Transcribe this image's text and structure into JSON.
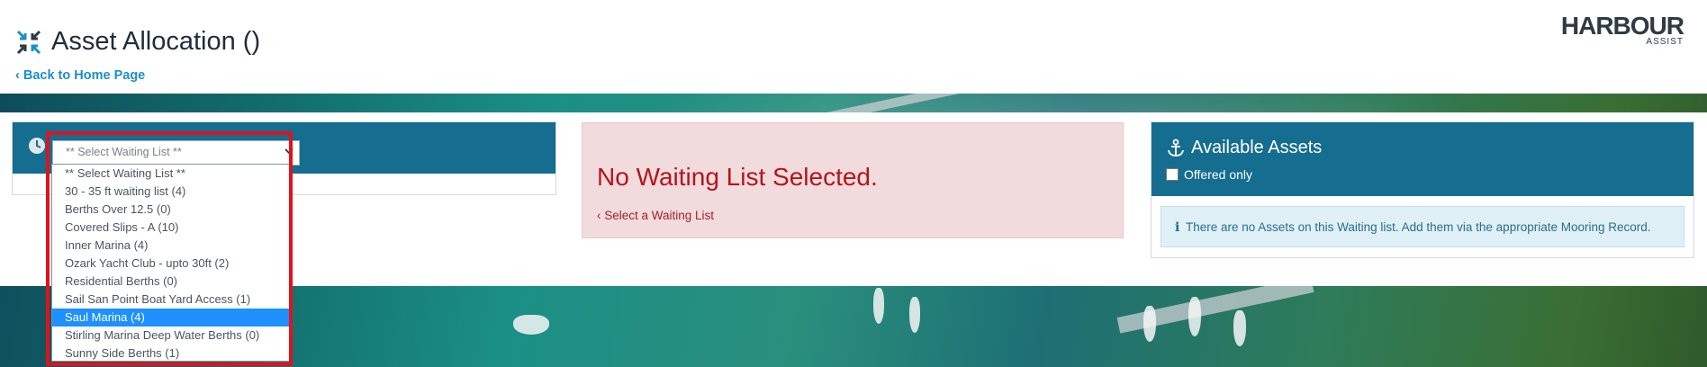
{
  "header": {
    "title": "Asset Allocation ()",
    "back_link": "Back to Home Page",
    "logo_main": "HARBOUR",
    "logo_sub": "ASSIST"
  },
  "waiting_list": {
    "select_value": "** Select Waiting List **",
    "options": [
      "** Select Waiting List **",
      "30 - 35 ft waiting list (4)",
      "Berths Over 12.5 (0)",
      "Covered Slips - A (10)",
      "Inner Marina (4)",
      "Ozark Yacht Club - upto 30ft (2)",
      "Residential Berths (0)",
      "Sail San Point Boat Yard Access (1)",
      "Saul Marina (4)",
      "Stirling Marina Deep Water Berths (0)",
      "Sunny Side Berths (1)"
    ],
    "highlighted_option": "Saul Marina (4)"
  },
  "alert": {
    "title": "No Waiting List Selected.",
    "link": "Select a Waiting List"
  },
  "assets": {
    "title": "Available Assets",
    "offered_only_label": "Offered only",
    "offered_only_checked": false,
    "info_text": "There are no Assets on this Waiting list. Add them via the appropriate Mooring Record."
  },
  "colors": {
    "panel_header": "#156d8f",
    "alert_bg": "#f2dbdd",
    "alert_text": "#b3161c",
    "link": "#1a8fc9",
    "highlight_border": "#e0121d",
    "dropdown_selected": "#1e90ff"
  },
  "icons": {
    "title": "compress-arrows-icon",
    "back": "chevron-left-icon",
    "clock": "clock-icon",
    "anchor": "anchor-icon",
    "info": "info-icon"
  }
}
